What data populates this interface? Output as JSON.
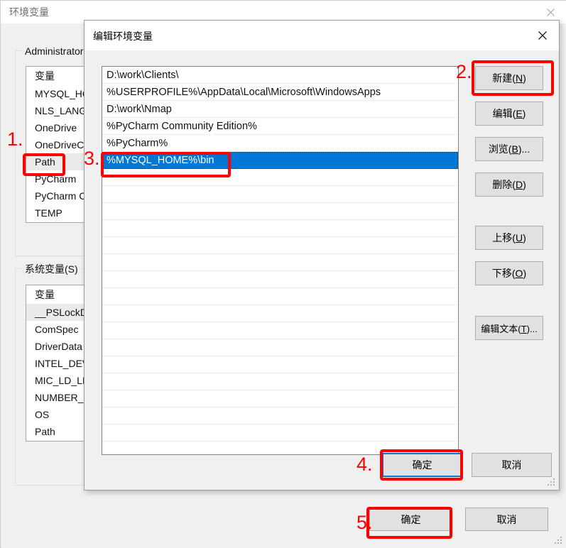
{
  "background_window": {
    "title": "环境变量",
    "close_icon": "close-icon",
    "user_group": {
      "legend": "Administrator",
      "column_header": "变量",
      "rows": [
        "MYSQL_HOME",
        "NLS_LANG",
        "OneDrive",
        "OneDriveConsumer",
        "Path",
        "PyCharm",
        "PyCharm Community",
        "TEMP"
      ]
    },
    "system_group": {
      "legend": "系统变量(S)",
      "column_header": "变量",
      "rows": [
        "__PSLockDownPolicy",
        "ComSpec",
        "DriverData",
        "INTEL_DEV_REDIST",
        "MIC_LD_LIBRARY_PATH",
        "NUMBER_OF_PROCESSORS",
        "OS",
        "Path"
      ]
    },
    "ok_label": "确定",
    "cancel_label": "取消"
  },
  "dialog": {
    "title": "编辑环境变量",
    "close_icon": "close-icon",
    "path_entries": [
      "D:\\work\\Clients\\",
      "%USERPROFILE%\\AppData\\Local\\Microsoft\\WindowsApps",
      "D:\\work\\Nmap",
      "%PyCharm Community Edition%",
      "%PyCharm%",
      "%MYSQL_HOME%\\bin"
    ],
    "selected_index": 5,
    "empty_row_count": 16,
    "buttons": {
      "new": {
        "text": "新建(",
        "accel": "N",
        "tail": ")"
      },
      "edit": {
        "text": "编辑(",
        "accel": "E",
        "tail": ")"
      },
      "browse": {
        "text": "浏览(",
        "accel": "B",
        "tail": ")..."
      },
      "delete": {
        "text": "删除(",
        "accel": "D",
        "tail": ")"
      },
      "move_up": {
        "text": "上移(",
        "accel": "U",
        "tail": ")"
      },
      "move_down": {
        "text": "下移(",
        "accel": "O",
        "tail": ")"
      },
      "edit_text": {
        "text": "编辑文本(",
        "accel": "T",
        "tail": ")..."
      }
    },
    "ok_label": "确定",
    "cancel_label": "取消"
  },
  "annotations": {
    "n1": "1.",
    "n2": "2.",
    "n3": "3.",
    "n4": "4.",
    "n5": "5."
  },
  "colors": {
    "selection_blue": "#0078d7",
    "annotation_red": "#fe0000",
    "dialog_face": "#f0f0f0",
    "button_face": "#e1e1e1"
  }
}
